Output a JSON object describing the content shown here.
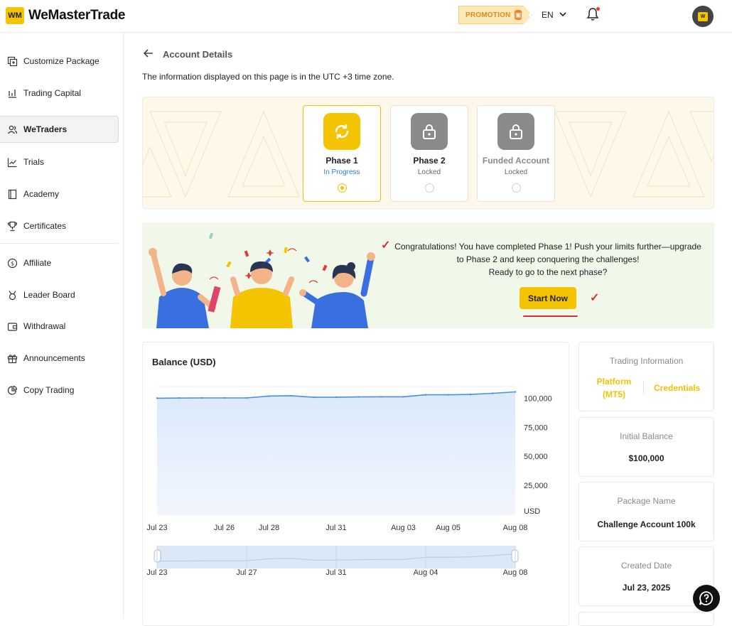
{
  "header": {
    "logo_text": "WeMasterTrade",
    "promo_label": "PROMOTION",
    "language": "EN"
  },
  "sidebar": {
    "items": [
      {
        "label": "Customize Package",
        "icon": "box-plus-icon"
      },
      {
        "label": "Trading Capital",
        "icon": "chart-bars-icon"
      },
      {
        "label": "WeTraders",
        "icon": "users-icon",
        "active": true
      },
      {
        "label": "Trials",
        "icon": "line-chart-icon"
      },
      {
        "label": "Academy",
        "icon": "book-icon"
      },
      {
        "label": "Certificates",
        "icon": "trophy-icon"
      },
      {
        "label": "Affiliate",
        "icon": "dollar-circle-icon"
      },
      {
        "label": "Leader Board",
        "icon": "medal-icon"
      },
      {
        "label": "Withdrawal",
        "icon": "wallet-icon"
      },
      {
        "label": "Announcements",
        "icon": "gift-icon"
      },
      {
        "label": "Copy Trading",
        "icon": "pie-chart-icon"
      }
    ]
  },
  "main": {
    "title": "Account Details",
    "timezone_note": "The information displayed on this page is in the UTC +3 time zone.",
    "phases": [
      {
        "name": "Phase 1",
        "status": "In Progress",
        "locked": false,
        "selected": true
      },
      {
        "name": "Phase 2",
        "status": "Locked",
        "locked": true,
        "selected": false
      },
      {
        "name": "Funded Account",
        "status": "Locked",
        "locked": true,
        "selected": false
      }
    ],
    "congrats": {
      "line1": "Congratulations! You have completed Phase 1! Push your limits further—upgrade to Phase 2 and keep conquering the challenges!",
      "line2": "Ready to go to the next phase?",
      "button": "Start Now"
    }
  },
  "colors": {
    "accent": "#f5c400",
    "chart_line": "#4a90e2",
    "chart_fill": "#dbe9fb",
    "status_blue": "#2f7dd6"
  },
  "info": {
    "trading_info_label": "Trading Information",
    "platform_link": "Platform (MT5)",
    "credentials_link": "Credentials",
    "initial_balance_label": "Initial Balance",
    "initial_balance_value": "$100,000",
    "package_name_label": "Package Name",
    "package_name_value": "Challenge Account 100k",
    "created_date_label": "Created Date",
    "created_date_value": "Jul 23, 2025"
  },
  "chart_data": {
    "type": "area",
    "title": "Balance (USD)",
    "ylabel": "USD",
    "ylim": [
      0,
      110000
    ],
    "yticks": [
      25000,
      50000,
      75000,
      100000
    ],
    "ytick_labels": [
      "25,000",
      "50,000",
      "75,000",
      "100,000"
    ],
    "xtick_labels": [
      "Jul 23",
      "Jul 26",
      "Jul 28",
      "Jul 31",
      "Aug 03",
      "Aug 05",
      "Aug 08"
    ],
    "x": [
      "Jul 23",
      "Jul 24",
      "Jul 25",
      "Jul 26",
      "Jul 27",
      "Jul 28",
      "Jul 29",
      "Jul 30",
      "Jul 31",
      "Aug 01",
      "Aug 02",
      "Aug 03",
      "Aug 04",
      "Aug 05",
      "Aug 06",
      "Aug 07",
      "Aug 08"
    ],
    "series": [
      {
        "values": [
          100000,
          100100,
          100200,
          100200,
          100200,
          101800,
          102100,
          100800,
          100800,
          101100,
          101200,
          101200,
          102900,
          102900,
          103200,
          104200,
          105400
        ]
      }
    ],
    "grid": true,
    "navigator_labels": [
      "Jul 23",
      "Jul 27",
      "Jul 31",
      "Aug 04",
      "Aug 08"
    ]
  }
}
